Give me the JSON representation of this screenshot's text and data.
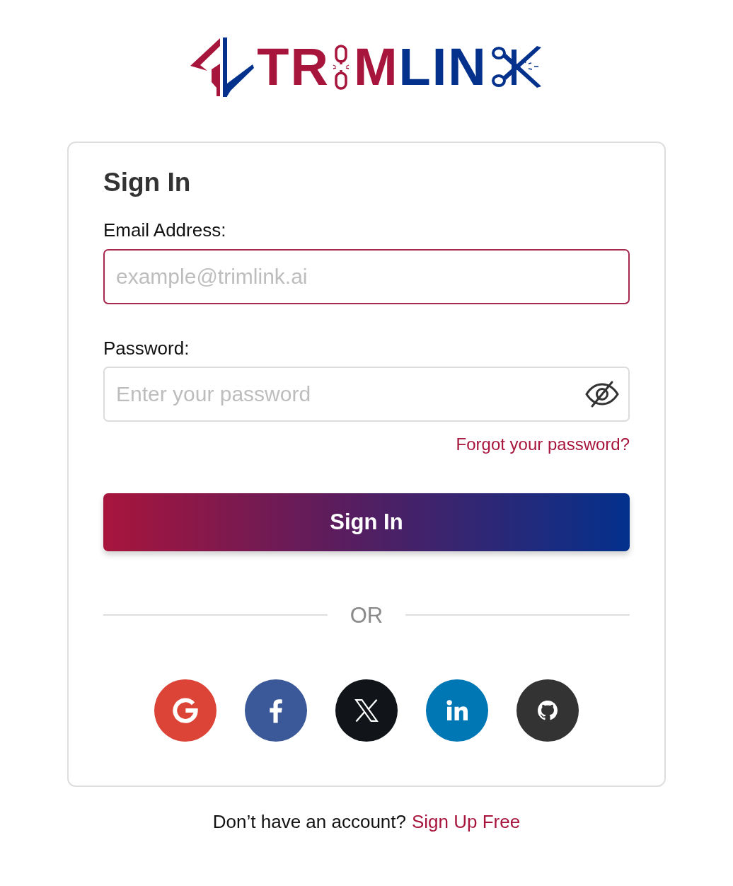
{
  "logo": {
    "segments": [
      {
        "kind": "text",
        "text": "TR",
        "color": "#a8153c"
      },
      {
        "kind": "chain",
        "color": "#a8153c"
      },
      {
        "kind": "text",
        "text": "M",
        "color": "#a8153c"
      },
      {
        "kind": "text",
        "text": "LIN",
        "color": "#03318c"
      },
      {
        "kind": "scissors",
        "color": "#03318c"
      }
    ]
  },
  "form": {
    "title": "Sign In",
    "fields": [
      {
        "kind": "email",
        "label": "Email Address:",
        "placeholder": "example@trimlink.ai",
        "focused": true
      },
      {
        "kind": "password",
        "label": "Password:",
        "placeholder": "Enter your password",
        "focused": false,
        "revealed": false
      }
    ],
    "forgot_link": "Forgot your password?",
    "submit": "Sign In",
    "divider": "OR",
    "social": [
      {
        "kind": "google",
        "color": "#db4437"
      },
      {
        "kind": "facebook",
        "color": "#3b5998"
      },
      {
        "kind": "x",
        "color": "#111418"
      },
      {
        "kind": "linkedin",
        "color": "#0077b5"
      },
      {
        "kind": "github",
        "color": "#333333"
      }
    ]
  },
  "footer": {
    "text": "Don’t have an account?",
    "link": "Sign Up Free"
  }
}
